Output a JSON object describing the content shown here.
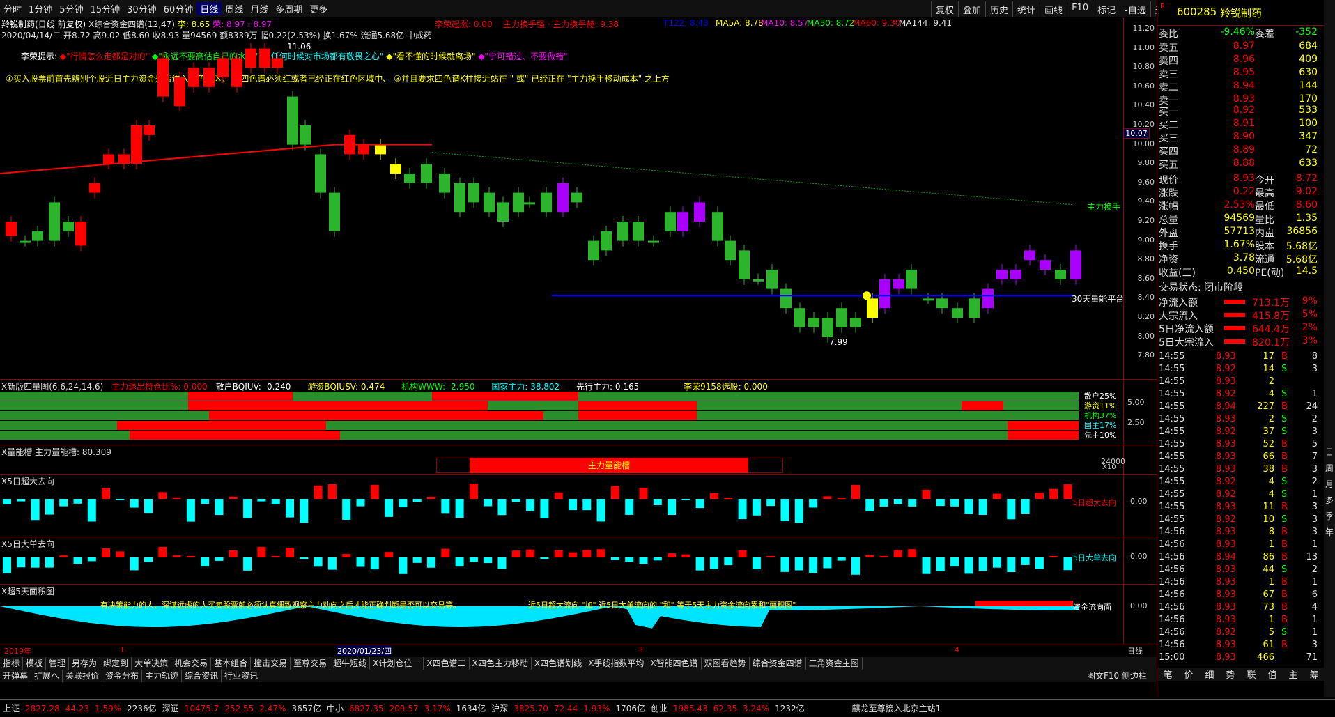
{
  "toolbar": {
    "tabs": [
      "分时",
      "1分钟",
      "5分钟",
      "15分钟",
      "30分钟",
      "60分钟",
      "日线",
      "周线",
      "月线",
      "多周期",
      "更多"
    ],
    "right": [
      "复权",
      "叠加",
      "历史",
      "统计",
      "画线",
      "F10",
      "标记",
      "-自选",
      "返回"
    ]
  },
  "header": {
    "stock": "羚锐制药(日线 前复权)",
    "indicator": "X综合资金四谱(12,47)",
    "li": "李: 8.65",
    "rong": "荣: 8.97 : 8.97",
    "ohlc": "2020/04/14/二 开8.72 高9.02 低8.60 收8.93 量94569 额8339万 幅0.22(2.53%) 换1.67% 流通5.68亿 中成药",
    "liqi": "李荣起涨: 0.00",
    "zhuli": "主力换手强 · 主力换手赫: 9.38",
    "t122": "T122: 8.43",
    "ma": [
      "MA5A: 8.78",
      "MA10: 8.57",
      "MA30: 8.72",
      "MA60: 9.30",
      "MA144: 9.41"
    ],
    "tip_label": "李荣提示:",
    "tips": [
      "\"行情怎么走都是对的\"",
      "\"永远不要高估自己的水平\"",
      "\"任何时候对市场都有敬畏之心\"",
      "\"看不懂的时候就离场\"",
      "\"宁可错过、不要做错\""
    ],
    "rule": "①买入股票前首先辨别个股近日主力资金是否进入红色柱区、 ②四色谱必须红或者已经正在红色区域中、 ③并且要求四色谱K柱接近站在 \" 或\" 已经正在 \"主力换手移动成本\" 之上方",
    "hi": "11.06",
    "lo": "7.99",
    "label_zhu": "主力换手",
    "label_30": "30天量能平台",
    "cur": "10.07"
  },
  "yaxis": [
    "11.20",
    "11.00",
    "10.80",
    "10.60",
    "10.40",
    "10.20",
    "10.00",
    "9.80",
    "9.60",
    "9.40",
    "9.20",
    "9.00",
    "8.80",
    "8.60",
    "8.40",
    "8.20",
    "8.00",
    "7.80"
  ],
  "panel2": {
    "title": "X新版四量图(6,6,24,14,6)",
    "a": "主力退出持仓比%: 0.000",
    "b": "散户BQIUV: -0.240",
    "c": "游资BQIUSV: 0.474",
    "d": "机构WWW: -2.950",
    "e": "国家主力: 38.802",
    "f": "先行主力: 0.165",
    "g": "李荣9158选股: 0.000",
    "labels": [
      "散户25%",
      "游资11%",
      "机构37%",
      "国主17%",
      "先主10%"
    ],
    "ax": [
      "5.00",
      "2.50"
    ]
  },
  "panel3": {
    "title": "X量能槽 主力量能槽: 80.309",
    "bar": "主力量能槽",
    "ax": "24000",
    "x10": "X10"
  },
  "panel4": {
    "title": "X5日超大去向",
    "label": "5日超大去向",
    "ax": "0.00"
  },
  "panel5": {
    "title": "X5日大单去向",
    "label": "5日大单去向",
    "ax": "0.00"
  },
  "panel6": {
    "title": "X超5天面积图",
    "text1": "有决策能力的人、深谋远虑的人买卖股票前必须认真细致观察主力动向之后才能正确判断是否可以交易等。",
    "text2": "近5日超大流向 \"加\" 近5日大单流向的 \"和\" 等于5天主力资金流向累和\"面积图\"",
    "label": "资金流向面",
    "ax": "0.00"
  },
  "xaxis": {
    "a": "2019年",
    "b": "1",
    "c": "2020/01/23/四",
    "d": "3",
    "e": "4",
    "daily": "日线"
  },
  "tabs1": [
    "指标",
    "模板",
    "管理",
    "另存为",
    "绑定到",
    "大单决策",
    "机会交易",
    "基本组合",
    "撞击交易",
    "至尊交易",
    "超牛短线",
    "X计划仓位一",
    "X四色谱二",
    "X四色主力移动",
    "X四色谱划线",
    "X手线指数平均",
    "X智能四色谱",
    "双图看趋势",
    "综合资金四谱",
    "三角资金主图"
  ],
  "tabs2": [
    "开弹幕",
    "扩展へ",
    "关联报价",
    "资金分布",
    "主力轨迹",
    "综合资讯",
    "行业资讯"
  ],
  "tabs2r": "图文F10 侧边栏",
  "quote": {
    "code": "600285",
    "name": "羚锐制药",
    "weibi": "委比",
    "wb": "-9.46%",
    "weicha": "委差",
    "wc": "-352",
    "sells": [
      [
        "卖五",
        "8.97",
        "684"
      ],
      [
        "卖四",
        "8.96",
        "409"
      ],
      [
        "卖三",
        "8.95",
        "630"
      ],
      [
        "卖二",
        "8.94",
        "144"
      ],
      [
        "卖一",
        "8.93",
        "170"
      ]
    ],
    "buys": [
      [
        "买一",
        "8.92",
        "533"
      ],
      [
        "买二",
        "8.91",
        "100"
      ],
      [
        "买三",
        "8.90",
        "347"
      ],
      [
        "买四",
        "8.89",
        "72"
      ],
      [
        "买五",
        "8.88",
        "633"
      ]
    ],
    "info": [
      [
        "现价",
        "8.93",
        "今开",
        "8.72"
      ],
      [
        "涨跌",
        "0.22",
        "最高",
        "9.02"
      ],
      [
        "涨幅",
        "2.53%",
        "最低",
        "8.60"
      ],
      [
        "总量",
        "94569",
        "量比",
        "1.35"
      ],
      [
        "外盘",
        "57713",
        "内盘",
        "36856"
      ],
      [
        "换手",
        "1.67%",
        "股本",
        "5.68亿"
      ],
      [
        "净资",
        "3.78",
        "流通",
        "5.68亿"
      ],
      [
        "收益(三)",
        "0.450",
        "PE(动)",
        "14.5"
      ]
    ],
    "state": "交易状态: 闭市阶段",
    "flows": [
      [
        "净流入额",
        "713.1万",
        "9%"
      ],
      [
        "大宗流入",
        "415.8万",
        "5%"
      ],
      [
        "5日净流入额",
        "644.4万",
        "2%"
      ],
      [
        "5日大宗流入",
        "820.1万",
        "3%"
      ]
    ],
    "ticks": [
      [
        "14:55",
        "8.93",
        "17",
        "B",
        "8"
      ],
      [
        "14:55",
        "8.92",
        "14",
        "S",
        "3"
      ],
      [
        "14:55",
        "8.93",
        "2",
        "",
        ""
      ],
      [
        "14:55",
        "8.92",
        "4",
        "S",
        "1"
      ],
      [
        "14:55",
        "8.94",
        "227",
        "B",
        "24"
      ],
      [
        "14:55",
        "8.93",
        "2",
        "S",
        "2"
      ],
      [
        "14:55",
        "8.92",
        "37",
        "S",
        "3"
      ],
      [
        "14:55",
        "8.93",
        "52",
        "B",
        "5"
      ],
      [
        "14:55",
        "8.93",
        "66",
        "B",
        "7"
      ],
      [
        "14:55",
        "8.93",
        "38",
        "B",
        "3"
      ],
      [
        "14:55",
        "8.92",
        "4",
        "S",
        "2"
      ],
      [
        "14:55",
        "8.92",
        "4",
        "S",
        "1"
      ],
      [
        "14:55",
        "8.93",
        "11",
        "B",
        "3"
      ],
      [
        "14:55",
        "8.92",
        "10",
        "S",
        "3"
      ],
      [
        "14:56",
        "8.93",
        "8",
        "B",
        "3"
      ],
      [
        "14:56",
        "8.93",
        "1",
        "B",
        "1"
      ],
      [
        "14:56",
        "8.94",
        "86",
        "B",
        "13"
      ],
      [
        "14:56",
        "8.93",
        "44",
        "S",
        "2"
      ],
      [
        "14:56",
        "8.93",
        "1",
        "B",
        "1"
      ],
      [
        "14:56",
        "8.93",
        "67",
        "B",
        "6"
      ],
      [
        "14:56",
        "8.93",
        "73",
        "B",
        "4"
      ],
      [
        "14:56",
        "8.93",
        "1",
        "B",
        "1"
      ],
      [
        "14:56",
        "8.92",
        "5",
        "S",
        "1"
      ],
      [
        "14:56",
        "8.93",
        "61",
        "B",
        "3"
      ],
      [
        "15:00",
        "8.93",
        "466",
        "",
        "71"
      ]
    ],
    "tabs": [
      "笔",
      "价",
      "细",
      "势",
      "联",
      "值",
      "主",
      "筹"
    ]
  },
  "sidebar": [
    "日",
    "周",
    "月",
    "多",
    "季",
    "年"
  ],
  "status": {
    "items": [
      [
        "上证",
        "2827.28",
        "44.23",
        "1.59%",
        "2236亿"
      ],
      [
        "深证",
        "10475.7",
        "252.55",
        "2.47%",
        "3657亿"
      ],
      [
        "中小",
        "6827.35",
        "209.57",
        "3.17%",
        "1634亿"
      ],
      [
        "沪深",
        "3825.70",
        "72.44",
        "1.93%",
        "1706亿"
      ],
      [
        "创业",
        "1985.43",
        "62.35",
        "3.24%",
        "1232亿"
      ]
    ],
    "msg": "麒龙至尊接入北京主站1"
  }
}
